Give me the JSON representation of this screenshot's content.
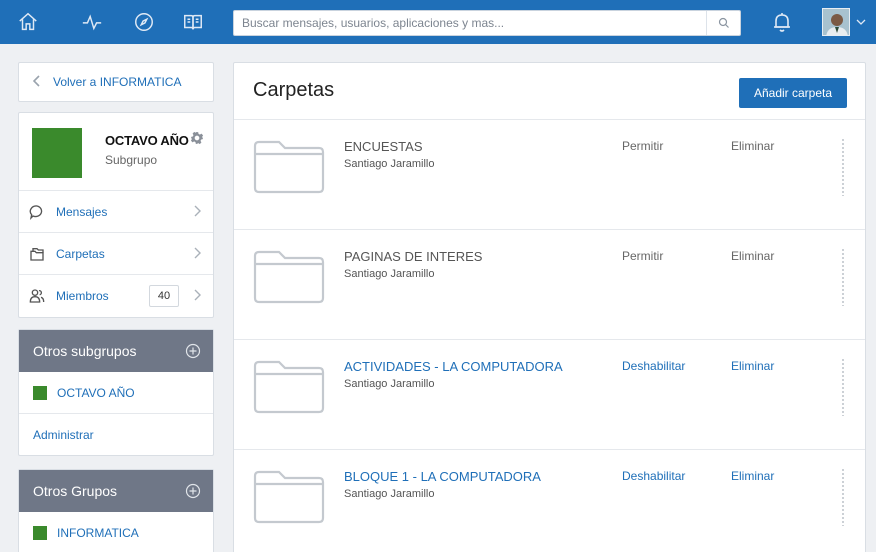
{
  "topbar": {
    "nav_icons": [
      "home-icon",
      "activity-icon",
      "compass-icon",
      "book-icon"
    ],
    "search_placeholder": "Buscar mensajes, usuarios, aplicaciones y mas...",
    "accent": "#1f6fb8"
  },
  "sidebar": {
    "back_label": "Volver a INFORMATICA",
    "group": {
      "name": "OCTAVO AÑO",
      "type": "Subgrupo",
      "color": "#3a8a2c"
    },
    "menu": [
      {
        "label": "Mensajes",
        "icon": "chat-icon"
      },
      {
        "label": "Carpetas",
        "icon": "folders-icon"
      },
      {
        "label": "Miembros",
        "icon": "members-icon",
        "count": "40"
      }
    ],
    "subgroups": {
      "title": "Otros subgrupos",
      "items": [
        "OCTAVO AÑO"
      ],
      "manage_label": "Administrar"
    },
    "other_groups": {
      "title": "Otros Grupos",
      "items": [
        "INFORMATICA"
      ]
    }
  },
  "main": {
    "title": "Carpetas",
    "add_label": "Añadir carpeta",
    "folders": [
      {
        "name": "ENCUESTAS",
        "owner": "Santiago Jaramillo",
        "action": "Permitir",
        "delete": "Eliminar"
      },
      {
        "name": "PAGINAS DE INTERES",
        "owner": "Santiago Jaramillo",
        "action": "Permitir",
        "delete": "Eliminar"
      },
      {
        "name": "ACTIVIDADES - LA COMPUTADORA",
        "owner": "Santiago Jaramillo",
        "action": "Deshabilitar",
        "delete": "Eliminar"
      },
      {
        "name": "BLOQUE 1 - LA COMPUTADORA",
        "owner": "Santiago Jaramillo",
        "action": "Deshabilitar",
        "delete": "Eliminar"
      }
    ]
  }
}
